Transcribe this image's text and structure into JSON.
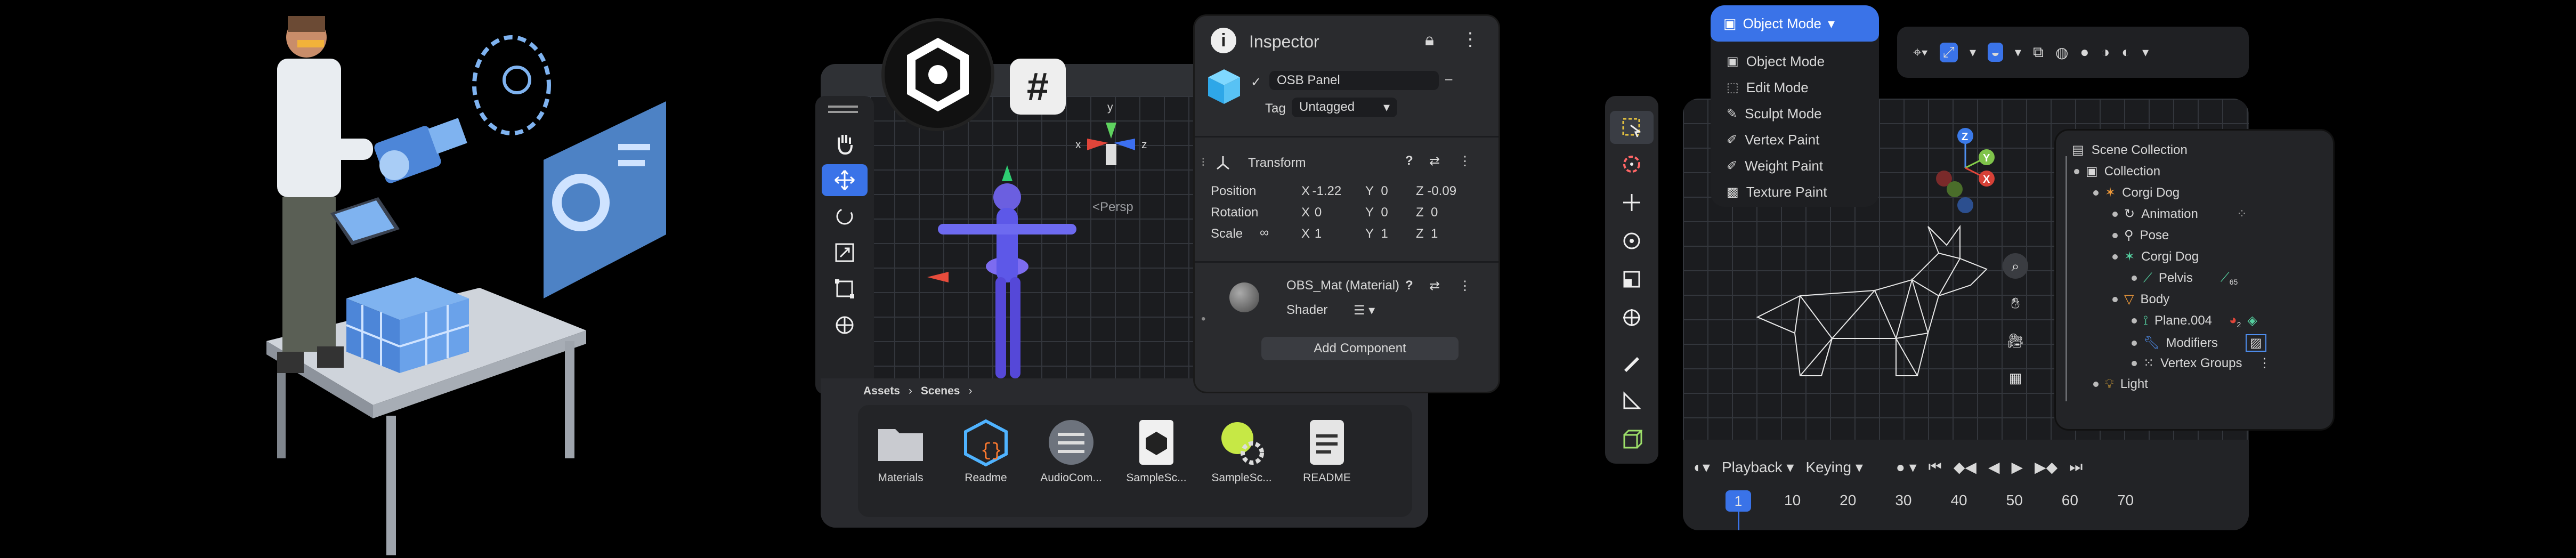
{
  "illustration": {
    "description_icons": [
      "engineer-figure",
      "tablet-icon",
      "camera-icon",
      "rotation-icon",
      "dashboard-screen"
    ]
  },
  "unity": {
    "logo_icon": "unity-logo-icon",
    "hash_label": "#",
    "tools": [
      "hand-tool-icon",
      "move-tool-icon",
      "rotate-tool-icon",
      "scale-tool-icon",
      "rect-tool-icon",
      "transform-tool-icon"
    ],
    "gizmo": {
      "x": "x",
      "y": "y",
      "z": "z"
    },
    "persp_label": "<Persp",
    "inspector": {
      "title": "Inspector",
      "object_name": "OSB Panel",
      "tag_label": "Tag",
      "tag_value": "Untagged",
      "transform_title": "Transform",
      "position_label": "Position",
      "rotation_label": "Rotation",
      "scale_label": "Scale",
      "pos": {
        "x": "-1.22",
        "y": "0",
        "z": "-0.09"
      },
      "rot": {
        "x": "0",
        "y": "0",
        "z": "0"
      },
      "scl": {
        "x": "1",
        "y": "1",
        "z": "1"
      },
      "axis_x": "X",
      "axis_y": "Y",
      "axis_z": "Z",
      "material_title": "OBS_Mat (Material)",
      "shader_label": "Shader",
      "add_component": "Add Component"
    },
    "breadcrumb": {
      "first": "Assets",
      "second": "Scenes"
    },
    "assets": [
      {
        "label": "Materials",
        "icon": "folder-icon"
      },
      {
        "label": "Readme",
        "icon": "script-cube-icon"
      },
      {
        "label": "AudioCom...",
        "icon": "audio-mixer-icon"
      },
      {
        "label": "SampleSc...",
        "icon": "unity-scene-icon"
      },
      {
        "label": "SampleSc...",
        "icon": "scene-settings-icon"
      },
      {
        "label": "README",
        "icon": "document-icon"
      }
    ]
  },
  "blender": {
    "mode_button": "Object Mode",
    "modes": [
      "Object Mode",
      "Edit Mode",
      "Sculpt Mode",
      "Vertex Paint",
      "Weight Paint",
      "Texture Paint"
    ],
    "toolbar_icons": [
      "select-box-icon",
      "cursor-icon",
      "move-icon",
      "rotate-icon",
      "scale-icon",
      "transform-icon",
      "annotate-icon",
      "measure-icon",
      "add-cube-icon"
    ],
    "outliner": {
      "title": "Scene Collection",
      "items": [
        {
          "label": "Collection",
          "indent": 0
        },
        {
          "label": "Corgi Dog",
          "indent": 1
        },
        {
          "label": "Animation",
          "indent": 2
        },
        {
          "label": "Pose",
          "indent": 2
        },
        {
          "label": "Corgi Dog",
          "indent": 2
        },
        {
          "label": "Pelvis",
          "indent": 3
        },
        {
          "label": "Body",
          "indent": 2
        },
        {
          "label": "Plane.004",
          "indent": 3
        },
        {
          "label": "Modifiers",
          "indent": 3
        },
        {
          "label": "Vertex Groups",
          "indent": 3
        },
        {
          "label": "Light",
          "indent": 1
        }
      ],
      "badge_pelvis": "65",
      "badge_plane": "2"
    },
    "nav_gizmo": {
      "z": "Z",
      "y": "Y",
      "x": "X"
    },
    "timeline": {
      "playback": "Playback",
      "keying": "Keying",
      "current_frame": "1",
      "frames": [
        "10",
        "20",
        "30",
        "40",
        "50",
        "60",
        "70"
      ]
    }
  }
}
